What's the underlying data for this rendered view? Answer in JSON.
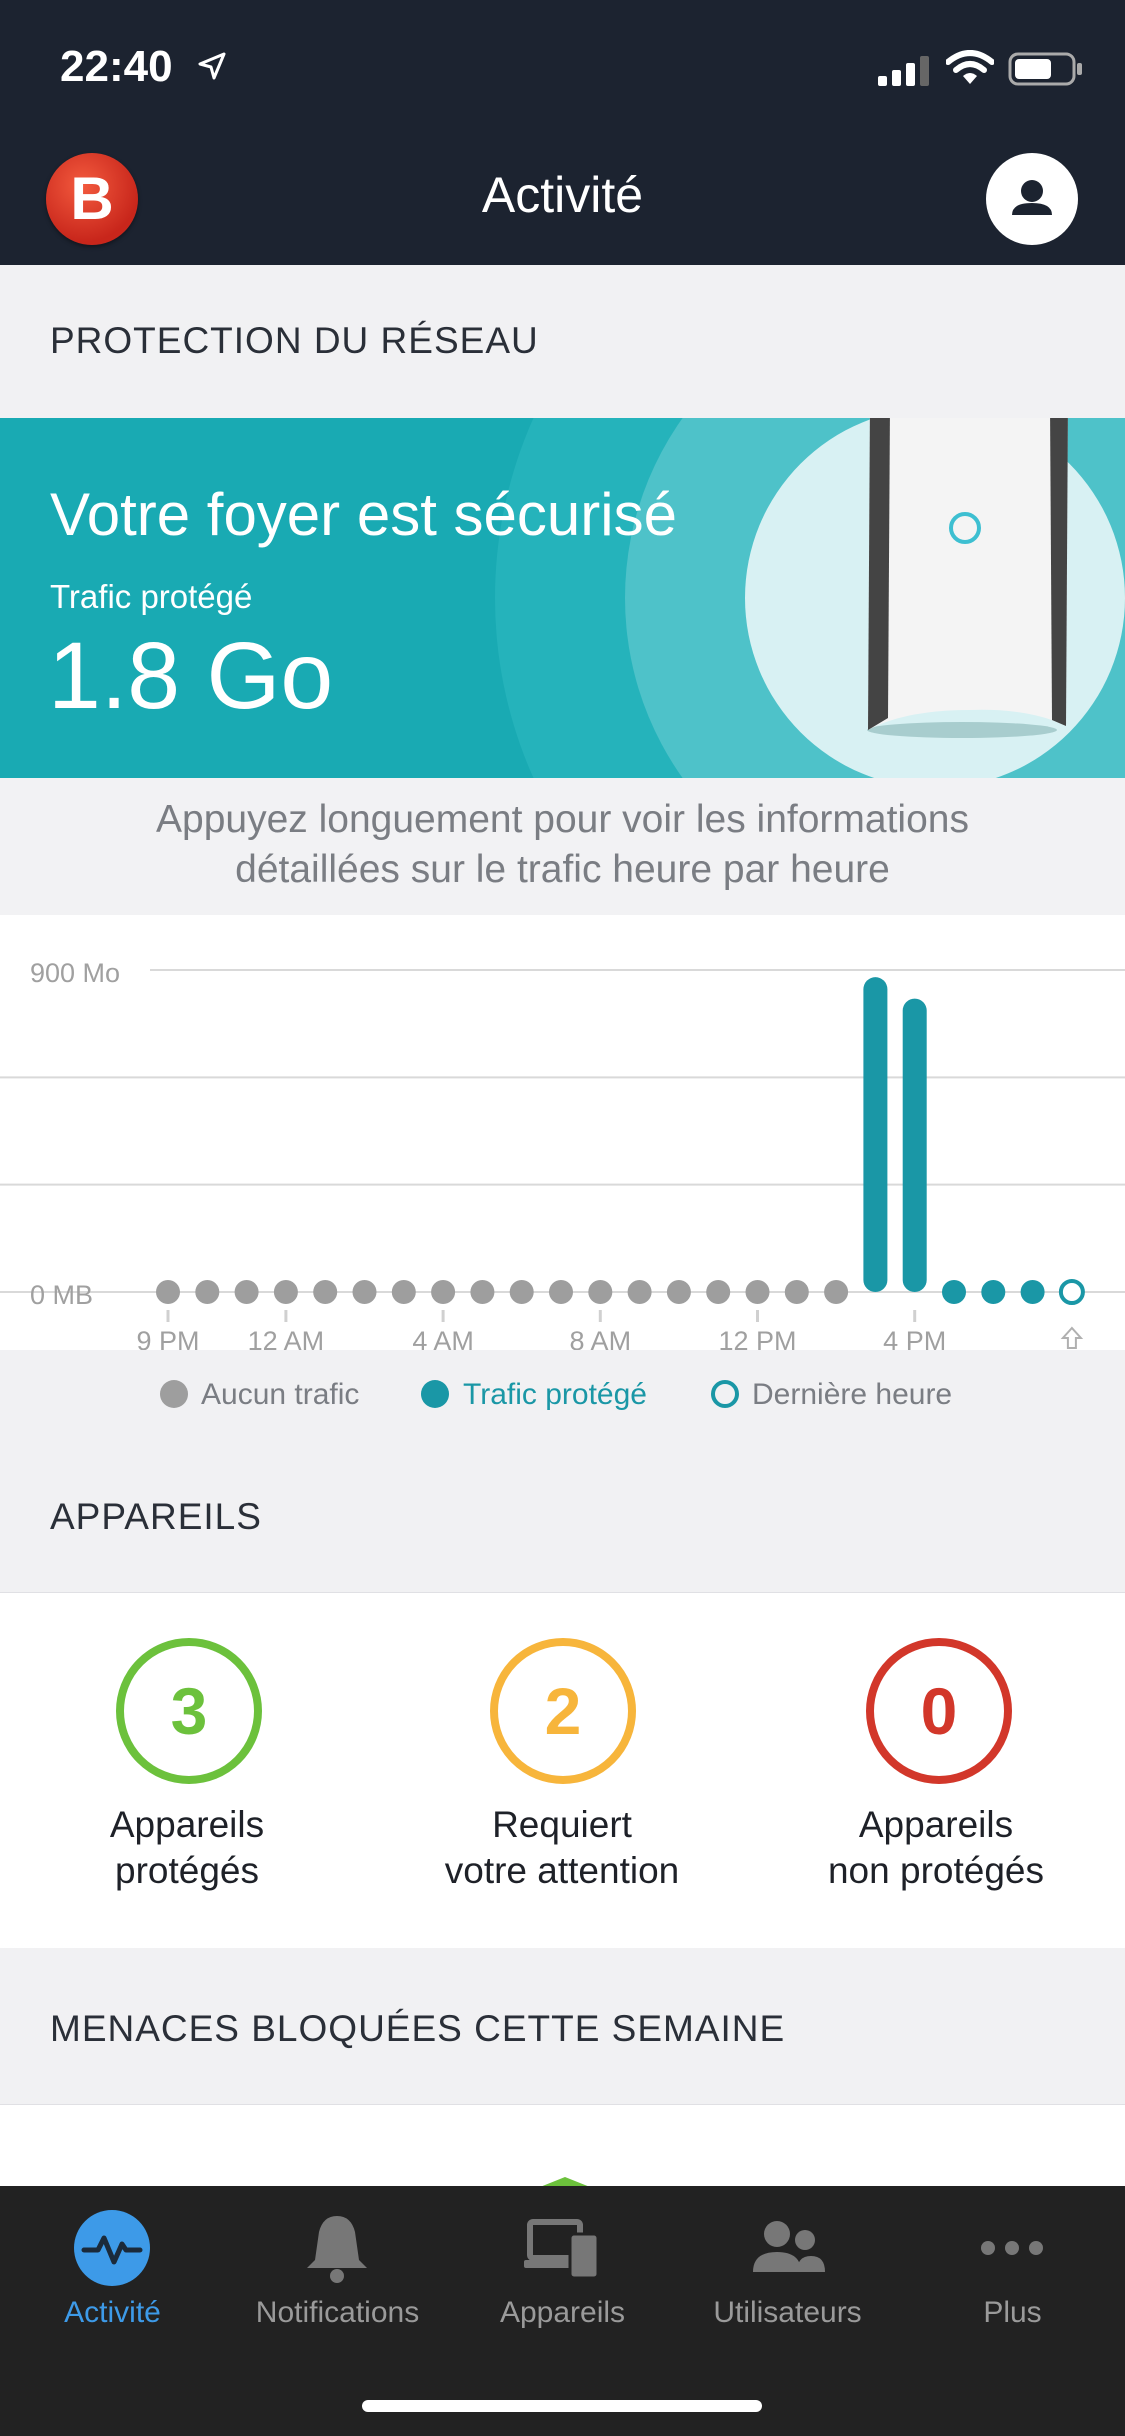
{
  "status": {
    "time": "22:40"
  },
  "header": {
    "title": "Activité"
  },
  "network": {
    "section_title": "PROTECTION DU RÉSEAU",
    "hero_title": "Votre foyer est sécurisé",
    "traffic_label": "Trafic protégé",
    "traffic_value": "1.8 Go",
    "hint_line1": "Appuyez longuement pour voir les informations",
    "hint_line2": "détaillées sur le trafic heure par heure"
  },
  "chart_data": {
    "type": "bar",
    "y_top_label": "900 Mo",
    "y_bottom_label": "0 MB",
    "ylim": [
      0,
      900
    ],
    "categories": [
      "9 PM",
      "10 PM",
      "11 PM",
      "12 AM",
      "1 AM",
      "2 AM",
      "3 AM",
      "4 AM",
      "5 AM",
      "6 AM",
      "7 AM",
      "8 AM",
      "9 AM",
      "10 AM",
      "11 AM",
      "12 PM",
      "1 PM",
      "2 PM",
      "3 PM",
      "4 PM",
      "5 PM",
      "6 PM",
      "7 PM",
      "8 PM"
    ],
    "x_tick_labels": [
      "9 PM",
      "12 AM",
      "4 AM",
      "8 AM",
      "12 PM",
      "4 PM"
    ],
    "values": [
      0,
      0,
      0,
      0,
      0,
      0,
      0,
      0,
      0,
      0,
      0,
      0,
      0,
      0,
      0,
      0,
      0,
      0,
      880,
      820,
      0,
      0,
      0,
      0
    ],
    "status": [
      "none",
      "none",
      "none",
      "none",
      "none",
      "none",
      "none",
      "none",
      "none",
      "none",
      "none",
      "none",
      "none",
      "none",
      "none",
      "none",
      "none",
      "none",
      "protected",
      "protected",
      "protected",
      "protected",
      "protected",
      "last"
    ],
    "colors": {
      "none": "#9e9e9e",
      "protected": "#1a97a6",
      "grid": "#d9d9d9"
    },
    "legend": [
      {
        "label": "Aucun trafic",
        "key": "none"
      },
      {
        "label": "Trafic protégé",
        "key": "protected"
      },
      {
        "label": "Dernière heure",
        "key": "last"
      }
    ]
  },
  "devices": {
    "section_title": "APPAREILS",
    "items": [
      {
        "count": "3",
        "line1": "Appareils",
        "line2": "protégés",
        "color": "#6cc13c"
      },
      {
        "count": "2",
        "line1": "Requiert",
        "line2": "votre attention",
        "color": "#f7b53b"
      },
      {
        "count": "0",
        "line1": "Appareils",
        "line2": "non protégés",
        "color": "#d2372a"
      }
    ]
  },
  "threats": {
    "section_title": "MENACES BLOQUÉES CETTE SEMAINE"
  },
  "tabs": [
    {
      "label": "Activité",
      "icon": "activity-icon",
      "active": true
    },
    {
      "label": "Notifications",
      "icon": "bell-icon"
    },
    {
      "label": "Appareils",
      "icon": "devices-icon"
    },
    {
      "label": "Utilisateurs",
      "icon": "users-icon"
    },
    {
      "label": "Plus",
      "icon": "more-icon"
    }
  ],
  "colors": {
    "accent": "#19aab3",
    "tab_active": "#3d9ae8",
    "header_bg": "#1c2330"
  }
}
